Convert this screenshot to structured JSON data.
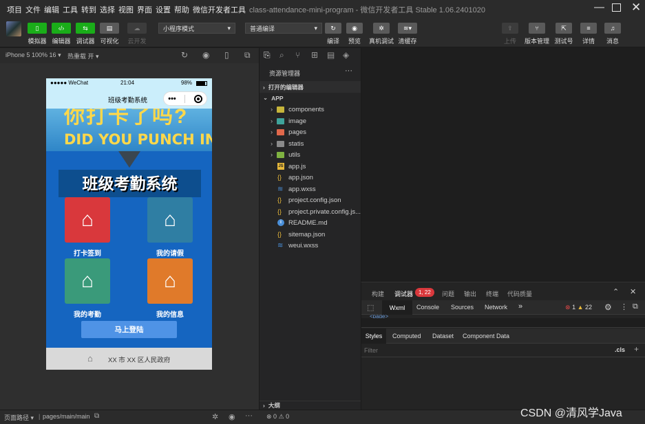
{
  "menubar": {
    "items": [
      "项目",
      "文件",
      "编辑",
      "工具",
      "转到",
      "选择",
      "视图",
      "界面",
      "设置",
      "帮助",
      "微信开发者工具"
    ],
    "title": "class-attendance-mini-program - 微信开发者工具 Stable 1.06.2401020"
  },
  "toolbar": {
    "left_buttons": [
      {
        "label": "模拟器",
        "icon": "phone-icon",
        "style": "green"
      },
      {
        "label": "编辑器",
        "icon": "code-icon",
        "style": "green"
      },
      {
        "label": "调试器",
        "icon": "debug-icon",
        "style": "green"
      },
      {
        "label": "可视化",
        "icon": "layout-icon",
        "style": "gray"
      },
      {
        "label": "云开发",
        "icon": "cloud-icon",
        "style": "dark"
      }
    ],
    "mode_select": "小程序模式",
    "compile_select": "普通编译",
    "mid_buttons": [
      {
        "label": "编译",
        "icon": "refresh-icon"
      },
      {
        "label": "预览",
        "icon": "eye-icon"
      },
      {
        "label": "真机调试",
        "icon": "bug-icon"
      },
      {
        "label": "清缓存",
        "icon": "layers-icon"
      }
    ],
    "right_buttons": [
      {
        "label": "上传",
        "icon": "upload-icon",
        "disabled": true
      },
      {
        "label": "版本管理",
        "icon": "branch-icon",
        "disabled": false
      },
      {
        "label": "测试号",
        "icon": "external-icon",
        "disabled": false
      },
      {
        "label": "详情",
        "icon": "menu-icon",
        "disabled": false
      },
      {
        "label": "消息",
        "icon": "bell-icon",
        "disabled": false
      }
    ]
  },
  "simulator": {
    "device": "iPhone 5 100% 16",
    "hot_reload": "热重载 开",
    "status": {
      "carrier": "●●●●● WeChat",
      "time": "21:04",
      "battery": "98%"
    },
    "nav_title": "班级考勤系统",
    "banner_text_top": "你打卡了吗?",
    "banner_text": "DID YOU PUNCH IN",
    "heading": "班级考勤系统",
    "tiles": [
      {
        "label": "打卡签到",
        "color": "#d9383c",
        "glyph": "",
        "icon": "house-icon"
      },
      {
        "label": "我的请假",
        "color": "#2f7ea3",
        "glyph": "¥",
        "icon": "house-yen-icon"
      },
      {
        "label": "我的考勤",
        "color": "#3a9a7a",
        "glyph": "",
        "icon": "school-icon"
      },
      {
        "label": "我的信息",
        "color": "#e07a2a",
        "glyph": "租",
        "icon": "house-rent-icon"
      }
    ],
    "login_button": "马上登陆",
    "footer": "XX 市 XX 区人民政府"
  },
  "explorer": {
    "title": "资源管理器",
    "open_editors": "打开的编辑器",
    "root": "APP",
    "folders": [
      {
        "name": "components",
        "color": "#c7b53b"
      },
      {
        "name": "image",
        "color": "#3fa39a"
      },
      {
        "name": "pages",
        "color": "#e0684b"
      },
      {
        "name": "statis",
        "color": "#8a8a8a"
      },
      {
        "name": "utils",
        "color": "#7fb241"
      }
    ],
    "files": [
      {
        "name": "app.js",
        "icon": "js-icon",
        "mark": "JS",
        "color": "#e8b93a"
      },
      {
        "name": "app.json",
        "icon": "json-icon",
        "mark": "{}",
        "color": "#e8b93a"
      },
      {
        "name": "app.wxss",
        "icon": "wxss-icon",
        "mark": "≋",
        "color": "#4a8fd8"
      },
      {
        "name": "project.config.json",
        "icon": "json-icon",
        "mark": "{}",
        "color": "#e8b93a"
      },
      {
        "name": "project.private.config.js...",
        "icon": "json-icon",
        "mark": "{}",
        "color": "#e8b93a"
      },
      {
        "name": "README.md",
        "icon": "info-icon",
        "mark": "i",
        "color": "#4a8fd8"
      },
      {
        "name": "sitemap.json",
        "icon": "json-icon",
        "mark": "{}",
        "color": "#e8b93a"
      },
      {
        "name": "weui.wxss",
        "icon": "wxss-icon",
        "mark": "≋",
        "color": "#4a8fd8"
      }
    ],
    "outline": "大纲"
  },
  "devtools": {
    "top_tabs": [
      "构建",
      "调试器",
      "问题",
      "输出",
      "终端",
      "代码质量"
    ],
    "badge": "1, 22",
    "panel_tabs": [
      "Wxml",
      "Console",
      "Sources",
      "Network"
    ],
    "more": "»",
    "errors": "1",
    "warnings": "22",
    "page_tag": "<page>",
    "style_tabs": [
      "Styles",
      "Computed",
      "Dataset",
      "Component Data"
    ],
    "filter_placeholder": "Filter",
    "cls": ".cls",
    "plus": "+"
  },
  "statusbar": {
    "path_label": "页面路径",
    "path": "pages/main/main",
    "errors": "0",
    "warnings": "0"
  },
  "watermark": "CSDN @清风学Java"
}
